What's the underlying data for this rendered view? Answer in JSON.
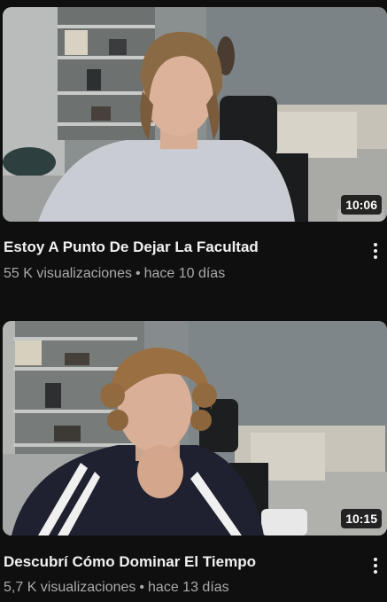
{
  "videos": [
    {
      "thumbnail_icon": "video-thumbnail",
      "duration": "10:06",
      "title": "Estoy A Punto De Dejar La Facultad",
      "views": "55 K visualizaciones",
      "separator": "•",
      "age": "hace 10 días",
      "menu_icon": "more-vert-icon"
    },
    {
      "thumbnail_icon": "video-thumbnail",
      "duration": "10:15",
      "title": "Descubrí Cómo Dominar El Tiempo",
      "views": "5,7 K visualizaciones",
      "separator": "•",
      "age": "hace 13 días",
      "menu_icon": "more-vert-icon"
    }
  ],
  "colors": {
    "background": "#0f0f0f",
    "title_text": "#f1f1f1",
    "meta_text": "#aaaaaa",
    "duration_badge": "#000000"
  }
}
